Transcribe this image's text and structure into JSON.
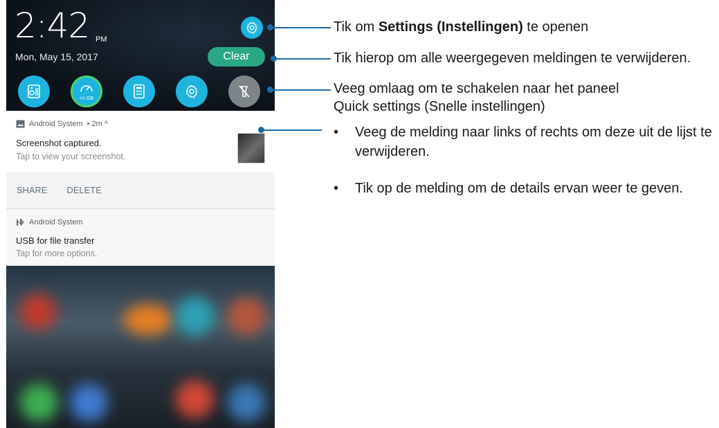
{
  "status": {
    "time": "2:42",
    "ampm": "PM",
    "date": "Mon, May 15, 2017",
    "clear_label": "Clear",
    "quick_settings": [
      {
        "icon": "sound-settings-icon",
        "state": "on"
      },
      {
        "icon": "memory-boost-icon",
        "state": "on",
        "caption": ">1 GB"
      },
      {
        "icon": "calculator-icon",
        "state": "on"
      },
      {
        "icon": "settings-icon",
        "state": "on"
      },
      {
        "icon": "flashlight-off-icon",
        "state": "off"
      }
    ]
  },
  "notifications": [
    {
      "app": "Android System",
      "meta": "• 2m ^",
      "title": "Screenshot captured.",
      "subtitle": "Tap to view your screenshot.",
      "actions": [
        "SHARE",
        "DELETE"
      ]
    },
    {
      "app": "Android System",
      "title": "USB for file transfer",
      "subtitle": "Tap for more options."
    }
  ],
  "annotations": {
    "settings_pre": "Tik om ",
    "settings_bold": "Settings (Instellingen)",
    "settings_post": " te openen",
    "clear": "Tik hierop om alle weergegeven meldingen te verwijderen.",
    "quick_line1": "Veeg omlaag om te schakelen naar het paneel",
    "quick_line2": "Quick settings (Snelle instellingen)",
    "bullet1": "Veeg de melding naar links of rechts om deze uit de lijst te verwijderen.",
    "bullet2": "Tik op de melding om de details ervan weer te geven."
  },
  "colors": {
    "accent_blue": "#1fb4e0",
    "clear_green": "#2aa785",
    "callout_line": "#1d6aa9"
  }
}
